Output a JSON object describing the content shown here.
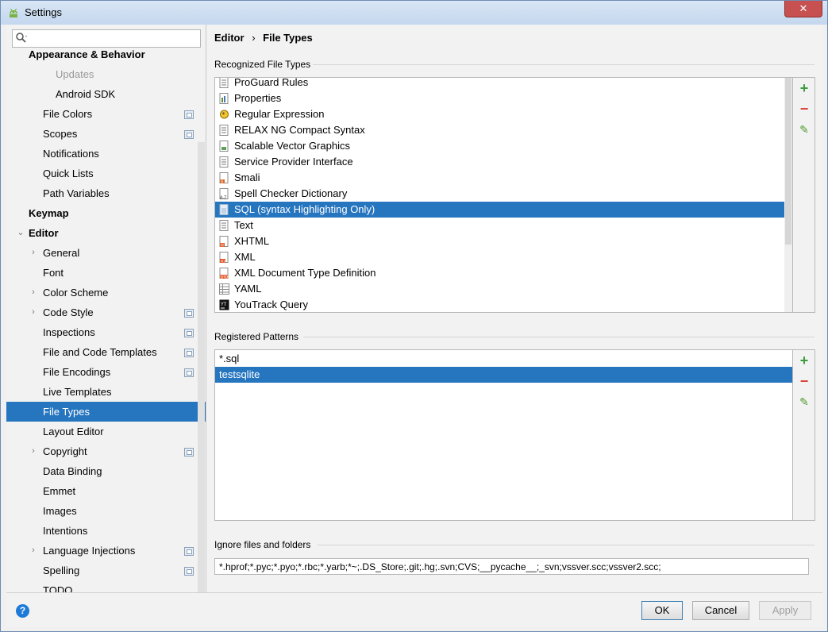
{
  "window": {
    "title": "Settings",
    "close_label": "✕"
  },
  "sidebar": {
    "search_placeholder": "",
    "items": [
      {
        "label": "Appearance & Behavior",
        "bold": true,
        "level": 0,
        "chevron": ""
      },
      {
        "label": "Updates",
        "level": 2,
        "chevron": ""
      },
      {
        "label": "Android SDK",
        "level": 2,
        "chevron": ""
      },
      {
        "label": "File Colors",
        "level": 1,
        "chevron": "",
        "project": true
      },
      {
        "label": "Scopes",
        "level": 1,
        "chevron": "",
        "project": true
      },
      {
        "label": "Notifications",
        "level": 1,
        "chevron": ""
      },
      {
        "label": "Quick Lists",
        "level": 1,
        "chevron": ""
      },
      {
        "label": "Path Variables",
        "level": 1,
        "chevron": ""
      },
      {
        "label": "Keymap",
        "bold": true,
        "level": 0,
        "chevron": ""
      },
      {
        "label": "Editor",
        "bold": true,
        "level": 0,
        "chevron": "⌄"
      },
      {
        "label": "General",
        "level": 1,
        "chevron": "›"
      },
      {
        "label": "Font",
        "level": 1,
        "chevron": ""
      },
      {
        "label": "Color Scheme",
        "level": 1,
        "chevron": "›"
      },
      {
        "label": "Code Style",
        "level": 1,
        "chevron": "›",
        "project": true
      },
      {
        "label": "Inspections",
        "level": 1,
        "chevron": "",
        "project": true
      },
      {
        "label": "File and Code Templates",
        "level": 1,
        "chevron": "",
        "project": true
      },
      {
        "label": "File Encodings",
        "level": 1,
        "chevron": "",
        "project": true
      },
      {
        "label": "Live Templates",
        "level": 1,
        "chevron": ""
      },
      {
        "label": "File Types",
        "level": 1,
        "chevron": "",
        "selected": true
      },
      {
        "label": "Layout Editor",
        "level": 1,
        "chevron": ""
      },
      {
        "label": "Copyright",
        "level": 1,
        "chevron": "›",
        "project": true
      },
      {
        "label": "Data Binding",
        "level": 1,
        "chevron": ""
      },
      {
        "label": "Emmet",
        "level": 1,
        "chevron": ""
      },
      {
        "label": "Images",
        "level": 1,
        "chevron": ""
      },
      {
        "label": "Intentions",
        "level": 1,
        "chevron": ""
      },
      {
        "label": "Language Injections",
        "level": 1,
        "chevron": "›",
        "project": true
      },
      {
        "label": "Spelling",
        "level": 1,
        "chevron": "",
        "project": true
      },
      {
        "label": "TODO",
        "level": 1,
        "chevron": ""
      }
    ]
  },
  "main": {
    "breadcrumb": {
      "parent": "Editor",
      "separator": "›",
      "current": "File Types"
    },
    "recognized": {
      "title": "Recognized File Types",
      "rows": [
        {
          "label": "ProGuard Rules",
          "icon": "text-file-icon"
        },
        {
          "label": "Properties",
          "icon": "properties-file-icon"
        },
        {
          "label": "Regular Expression",
          "icon": "regex-icon"
        },
        {
          "label": "RELAX NG Compact Syntax",
          "icon": "text-file-icon"
        },
        {
          "label": "Scalable Vector Graphics",
          "icon": "svg-file-icon"
        },
        {
          "label": "Service Provider Interface",
          "icon": "text-file-icon"
        },
        {
          "label": "Smali",
          "icon": "smali-file-icon"
        },
        {
          "label": "Spell Checker Dictionary",
          "icon": "dictionary-file-icon"
        },
        {
          "label": "SQL (syntax Highlighting Only)",
          "icon": "sql-file-icon",
          "selected": true
        },
        {
          "label": "Text",
          "icon": "text-file-icon"
        },
        {
          "label": "XHTML",
          "icon": "xhtml-file-icon"
        },
        {
          "label": "XML",
          "icon": "xml-file-icon"
        },
        {
          "label": "XML Document Type Definition",
          "icon": "dtd-file-icon"
        },
        {
          "label": "YAML",
          "icon": "yaml-file-icon"
        },
        {
          "label": "YouTrack Query",
          "icon": "youtrack-icon"
        }
      ]
    },
    "patterns": {
      "title": "Registered Patterns",
      "rows": [
        {
          "label": "*.sql"
        },
        {
          "label": "testsqlite",
          "selected": true
        }
      ]
    },
    "ignore": {
      "title": "Ignore files and folders",
      "value": "*.hprof;*.pyc;*.pyo;*.rbc;*.yarb;*~;.DS_Store;.git;.hg;.svn;CVS;__pycache__;_svn;vssver.scc;vssver2.scc;"
    },
    "tools": {
      "add": "+",
      "remove": "−",
      "edit": "✎"
    }
  },
  "footer": {
    "help": "?",
    "ok": "OK",
    "cancel": "Cancel",
    "apply": "Apply"
  },
  "colors": {
    "selection": "#2675bf",
    "add": "#3c9b3c",
    "remove": "#d9453a",
    "edit": "#4e9a2e"
  }
}
